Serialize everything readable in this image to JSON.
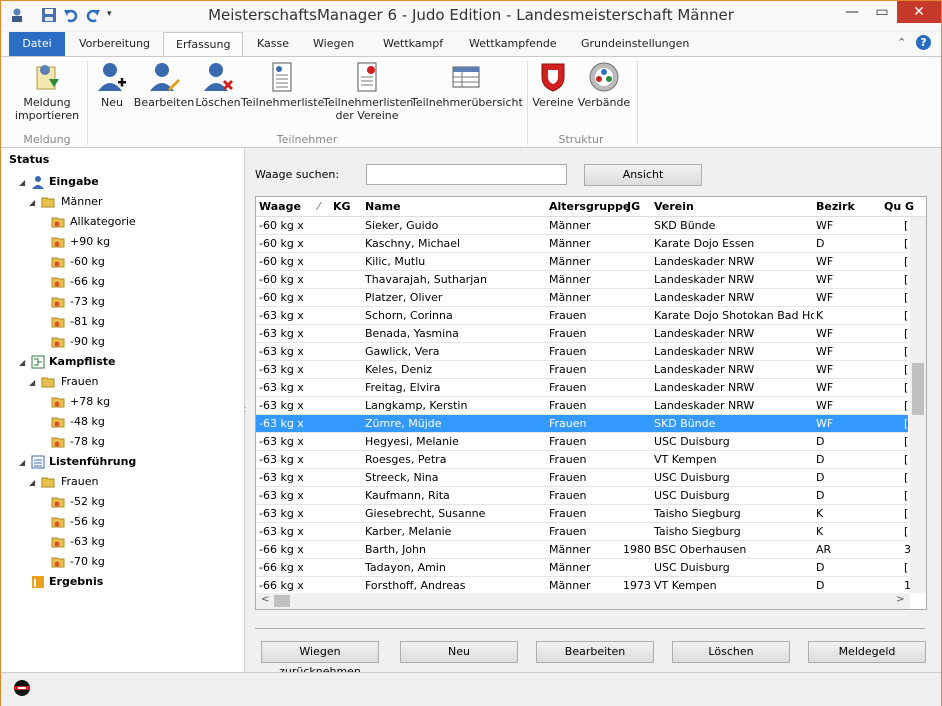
{
  "window": {
    "title": "MeisterschaftsManager 6 - Judo Edition - Landesmeisterschaft Männer",
    "minimize": "—",
    "restore": "▭",
    "close": "✕"
  },
  "ribbon_tabs": [
    "Datei",
    "Vorbereitung",
    "Erfassung",
    "Kasse",
    "Wiegen",
    "Wettkampf",
    "Wettkampfende",
    "Grundeinstellungen"
  ],
  "ribbon": {
    "meldung": {
      "import_label_1": "Meldung",
      "import_label_2": "importieren",
      "group": "Meldung"
    },
    "teilnehmer": {
      "neu": "Neu",
      "bearbeiten": "Bearbeiten",
      "loeschen": "Löschen",
      "liste": "Teilnehmerliste",
      "listen_vereine_1": "Teilnehmerlisten",
      "listen_vereine_2": "der Vereine",
      "uebersicht": "Teilnehmerübersicht",
      "group": "Teilnehmer"
    },
    "struktur": {
      "vereine": "Vereine",
      "verbaende": "Verbände",
      "group": "Struktur"
    }
  },
  "tree": {
    "status": "Status",
    "eingabe": "Eingabe",
    "maenner": "Männer",
    "maenner_items": [
      "Allkategorie",
      "+90 kg",
      "-60 kg",
      "-66 kg",
      "-73 kg",
      "-81 kg",
      "-90 kg"
    ],
    "kampfliste": "Kampfliste",
    "frauen1": "Frauen",
    "frauen1_items": [
      "+78 kg",
      "-48 kg",
      "-78 kg"
    ],
    "listenfuehrung": "Listenführung",
    "frauen2": "Frauen",
    "frauen2_items": [
      "-52 kg",
      "-56 kg",
      "-63 kg",
      "-70 kg"
    ],
    "ergebnis": "Ergebnis"
  },
  "search": {
    "label": "Waage suchen:",
    "value": "",
    "view_button": "Ansicht"
  },
  "grid": {
    "headers": {
      "waage": "Waage",
      "kg": "KG",
      "name": "Name",
      "altersgruppe": "Altersgruppe",
      "jg": "JG",
      "verein": "Verein",
      "bezirk": "Bezirk",
      "qu": "Qu G"
    },
    "rows": [
      {
        "waage": "-60 kg x",
        "name": "Sieker, Guido",
        "ag": "Männer",
        "jg": "",
        "verein": "SKD Bünde",
        "bezirk": "WF",
        "qu": "["
      },
      {
        "waage": "-60 kg x",
        "name": "Kaschny, Michael",
        "ag": "Männer",
        "jg": "",
        "verein": "Karate Dojo Essen",
        "bezirk": "D",
        "qu": "["
      },
      {
        "waage": "-60 kg x",
        "name": "Kilic, Mutlu",
        "ag": "Männer",
        "jg": "",
        "verein": "Landeskader NRW",
        "bezirk": "WF",
        "qu": "["
      },
      {
        "waage": "-60 kg x",
        "name": "Thavarajah, Sutharjan",
        "ag": "Männer",
        "jg": "",
        "verein": "Landeskader NRW",
        "bezirk": "WF",
        "qu": "["
      },
      {
        "waage": "-60 kg x",
        "name": "Platzer, Oliver",
        "ag": "Männer",
        "jg": "",
        "verein": "Landeskader NRW",
        "bezirk": "WF",
        "qu": "["
      },
      {
        "waage": "-63 kg x",
        "name": "Schorn, Corinna",
        "ag": "Frauen",
        "jg": "",
        "verein": "Karate Dojo Shotokan Bad Honnef",
        "bezirk": "K",
        "qu": "["
      },
      {
        "waage": "-63 kg x",
        "name": "Benada, Yasmina",
        "ag": "Frauen",
        "jg": "",
        "verein": "Landeskader NRW",
        "bezirk": "WF",
        "qu": "["
      },
      {
        "waage": "-63 kg x",
        "name": "Gawlick, Vera",
        "ag": "Frauen",
        "jg": "",
        "verein": "Landeskader NRW",
        "bezirk": "WF",
        "qu": "["
      },
      {
        "waage": "-63 kg x",
        "name": "Keles, Deniz",
        "ag": "Frauen",
        "jg": "",
        "verein": "Landeskader NRW",
        "bezirk": "WF",
        "qu": "["
      },
      {
        "waage": "-63 kg x",
        "name": "Freitag, Elvira",
        "ag": "Frauen",
        "jg": "",
        "verein": "Landeskader NRW",
        "bezirk": "WF",
        "qu": "["
      },
      {
        "waage": "-63 kg x",
        "name": "Langkamp, Kerstin",
        "ag": "Frauen",
        "jg": "",
        "verein": "Landeskader NRW",
        "bezirk": "WF",
        "qu": "["
      },
      {
        "waage": "-63 kg x",
        "name": "Zümre, Müjde",
        "ag": "Frauen",
        "jg": "",
        "verein": "SKD Bünde",
        "bezirk": "WF",
        "qu": "[",
        "selected": true
      },
      {
        "waage": "-63 kg x",
        "name": "Hegyesi, Melanie",
        "ag": "Frauen",
        "jg": "",
        "verein": "USC Duisburg",
        "bezirk": "D",
        "qu": "["
      },
      {
        "waage": "-63 kg x",
        "name": "Roesges, Petra",
        "ag": "Frauen",
        "jg": "",
        "verein": "VT Kempen",
        "bezirk": "D",
        "qu": "["
      },
      {
        "waage": "-63 kg x",
        "name": "Streeck, Nina",
        "ag": "Frauen",
        "jg": "",
        "verein": "USC Duisburg",
        "bezirk": "D",
        "qu": "["
      },
      {
        "waage": "-63 kg x",
        "name": "Kaufmann, Rita",
        "ag": "Frauen",
        "jg": "",
        "verein": "USC Duisburg",
        "bezirk": "D",
        "qu": "["
      },
      {
        "waage": "-63 kg x",
        "name": "Giesebrecht, Susanne",
        "ag": "Frauen",
        "jg": "",
        "verein": "Taisho Siegburg",
        "bezirk": "K",
        "qu": "["
      },
      {
        "waage": "-63 kg x",
        "name": "Karber, Melanie",
        "ag": "Frauen",
        "jg": "",
        "verein": "Taisho Siegburg",
        "bezirk": "K",
        "qu": "["
      },
      {
        "waage": "-66 kg x",
        "name": "Barth, John",
        "ag": "Männer",
        "jg": "1980",
        "verein": "BSC Oberhausen",
        "bezirk": "AR",
        "qu": "3"
      },
      {
        "waage": "-66 kg x",
        "name": "Tadayon, Amin",
        "ag": "Männer",
        "jg": "",
        "verein": "USC Duisburg",
        "bezirk": "D",
        "qu": "["
      },
      {
        "waage": "-66 kg x",
        "name": "Forsthoff, Andreas",
        "ag": "Männer",
        "jg": "1973",
        "verein": "VT Kempen",
        "bezirk": "D",
        "qu": "1"
      }
    ]
  },
  "buttons": {
    "wiegen_zurueck": "Wiegen zurücknehmen",
    "neu": "Neu",
    "bearbeiten": "Bearbeiten",
    "loeschen": "Löschen",
    "meldegeld": "Meldegeld"
  },
  "colors": {
    "accent": "#2b6cc4",
    "selection": "#3399ff",
    "close": "#c7392a"
  }
}
